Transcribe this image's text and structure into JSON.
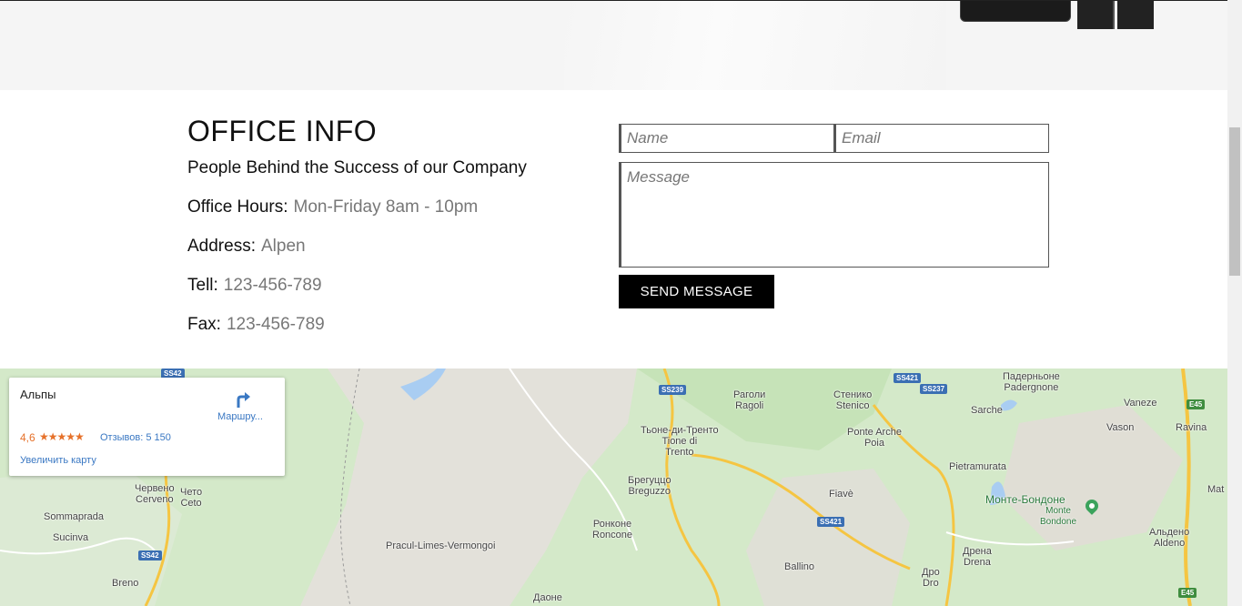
{
  "office": {
    "title": "OFFICE INFO",
    "subtitle": "People Behind the Success of our Company",
    "hours_label": "Office Hours:",
    "hours_value": "Mon-Friday 8am - 10pm",
    "address_label": "Address:",
    "address_value": "Alpen",
    "tell_label": "Tell:",
    "tell_value": "123-456-789",
    "fax_label": "Fax:",
    "fax_value": "123-456-789"
  },
  "form": {
    "name_placeholder": "Name",
    "email_placeholder": "Email",
    "message_placeholder": "Message",
    "send_label": "SEND MESSAGE"
  },
  "map_card": {
    "place": "Альпы",
    "directions_label": "Маршру...",
    "rating": "4,6",
    "stars": "★★★★★",
    "reviews": "Отзывов: 5 150",
    "enlarge": "Увеличить карту"
  },
  "map": {
    "labels": [
      "Раголи\nRagoli",
      "Стенико\nStenico",
      "Падерньоне\nPadergnone",
      "Vaneze",
      "Sarche",
      "Vason",
      "Ravina",
      "Тьоне-ди-Тренто\nTione di\nTrento",
      "Ponte Arche\nPoia",
      "Pietramurata",
      "Брегуццо\nBreguzzo",
      "Fiavè",
      "Червено\nCerveno",
      "Чето\nCeto",
      "Sommaprada",
      "Sucinva",
      "Ронконе\nRoncone",
      "Pracul-Limes-Vermongoi",
      "Ballino",
      "Дрена\nDrena",
      "Дро\nDro",
      "Альдено\nAldeno",
      "Breno",
      "Даоне",
      "Mat"
    ],
    "park_label": "Монте-Бондоне",
    "park_sub": "Monte\nBondone",
    "shields": [
      "SS42",
      "SS239",
      "SS421",
      "SS237",
      "SS421",
      "SS42",
      "E45",
      "E45"
    ]
  },
  "colors": {
    "accent": "#000000",
    "link": "#3a78c3",
    "rating": "#e6712a",
    "map_green": "#cfe8c3"
  }
}
